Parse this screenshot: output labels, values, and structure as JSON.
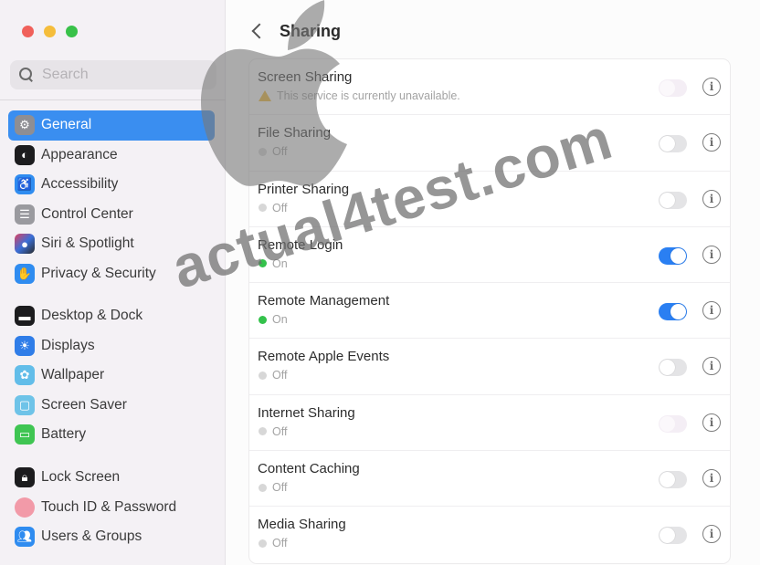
{
  "window": {
    "traffic_lights": [
      "close",
      "minimize",
      "zoom"
    ]
  },
  "sidebar": {
    "search": {
      "placeholder": "Search",
      "value": ""
    },
    "items": [
      {
        "label": "General",
        "icon": "gear-icon",
        "active": true,
        "color": "#8e8e93"
      },
      {
        "label": "Appearance",
        "icon": "appearance-icon",
        "active": false,
        "color": "#1c1c1e"
      },
      {
        "label": "Accessibility",
        "icon": "accessibility-icon",
        "active": false,
        "color": "#2f8cf0"
      },
      {
        "label": "Control Center",
        "icon": "control-center-icon",
        "active": false,
        "color": "#9a9a9f"
      },
      {
        "label": "Siri & Spotlight",
        "icon": "siri-icon",
        "active": false,
        "color": "#6b3a8a"
      },
      {
        "label": "Privacy & Security",
        "icon": "hand-icon",
        "active": false,
        "color": "#2f8cf0"
      },
      {
        "label": "Desktop & Dock",
        "icon": "dock-icon",
        "active": false,
        "color": "#1c1c1e"
      },
      {
        "label": "Displays",
        "icon": "sun-icon",
        "active": false,
        "color": "#2f7de8"
      },
      {
        "label": "Wallpaper",
        "icon": "wallpaper-icon",
        "active": false,
        "color": "#62bde9"
      },
      {
        "label": "Screen Saver",
        "icon": "screen-saver-icon",
        "active": false,
        "color": "#6ec3e8"
      },
      {
        "label": "Battery",
        "icon": "battery-icon",
        "active": false,
        "color": "#3fc552"
      },
      {
        "label": "Lock Screen",
        "icon": "lock-icon",
        "active": false,
        "color": "#1c1c1e"
      },
      {
        "label": "Touch ID & Password",
        "icon": "fingerprint-icon",
        "active": false,
        "color": "#f29aa8"
      },
      {
        "label": "Users & Groups",
        "icon": "users-icon",
        "active": false,
        "color": "#2f8cf0"
      }
    ]
  },
  "main": {
    "title": "Sharing",
    "back_label": "Back",
    "services": [
      {
        "name": "Screen Sharing",
        "status": "This service is currently unavailable.",
        "state": "unavailable",
        "toggle": "disabled"
      },
      {
        "name": "File Sharing",
        "status": "Off",
        "state": "off",
        "toggle": "off"
      },
      {
        "name": "Printer Sharing",
        "status": "Off",
        "state": "off",
        "toggle": "off"
      },
      {
        "name": "Remote Login",
        "status": "On",
        "state": "on",
        "toggle": "on"
      },
      {
        "name": "Remote Management",
        "status": "On",
        "state": "on",
        "toggle": "on"
      },
      {
        "name": "Remote Apple Events",
        "status": "Off",
        "state": "off",
        "toggle": "off"
      },
      {
        "name": "Internet Sharing",
        "status": "Off",
        "state": "off",
        "toggle": "disabled"
      },
      {
        "name": "Content Caching",
        "status": "Off",
        "state": "off",
        "toggle": "off"
      },
      {
        "name": "Media Sharing",
        "status": "Off",
        "state": "off",
        "toggle": "off"
      }
    ],
    "info_glyph": "i"
  },
  "colors": {
    "accent": "#3a8ef0",
    "toggle_on": "#2a7ff2",
    "status_on": "#34c24b",
    "status_off": "#d7d7d7",
    "warning": "#f2b92e"
  },
  "watermark": {
    "text": "actual4test.com"
  }
}
